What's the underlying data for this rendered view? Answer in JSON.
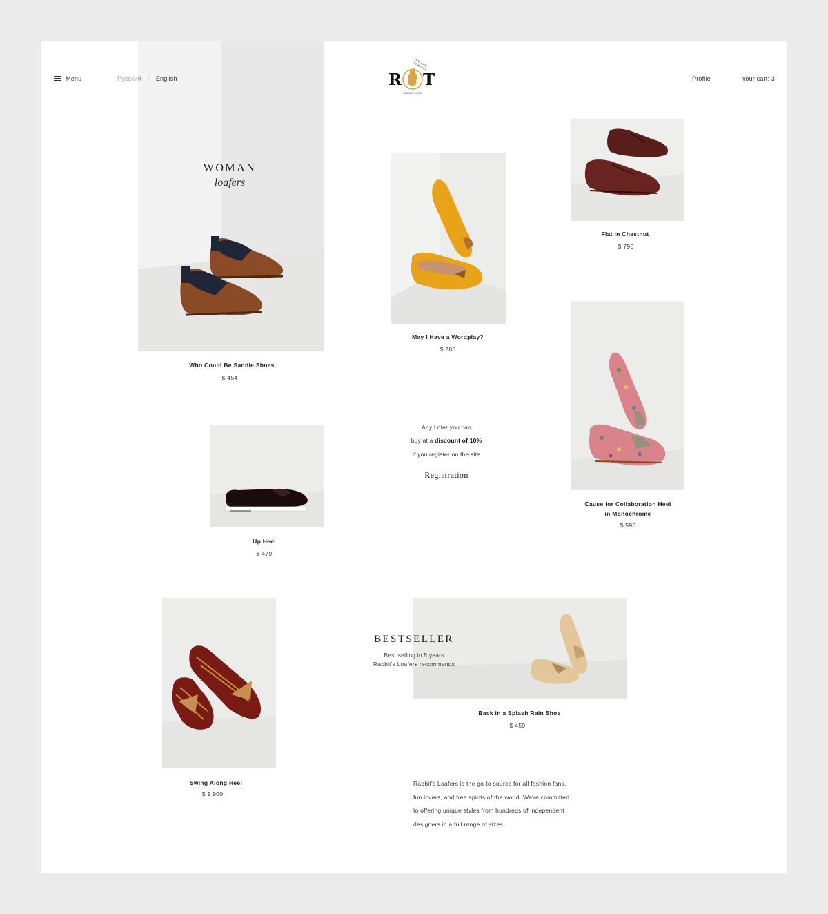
{
  "header": {
    "menu_label": "Menu",
    "languages": [
      {
        "label": "Русский",
        "active": false
      },
      {
        "label": "English",
        "active": true
      }
    ],
    "logo": {
      "letter_left": "R",
      "letter_right": "T",
      "arc_top": "WE ARE LOAFERS",
      "arc_bottom": "SINCE 2015"
    },
    "profile_label": "Profile",
    "cart_label": "Your cart: 3"
  },
  "hero": {
    "title": "WOMAN",
    "subtitle": "loafers"
  },
  "products": [
    {
      "name": "Who Could Be Saddle Shoes",
      "price": "$ 454"
    },
    {
      "name": "May I Have a Wordplay?",
      "price": "$ 280"
    },
    {
      "name": "Flat in Chestnut",
      "price": "$ 790"
    },
    {
      "name": "Up Heel",
      "price": "$ 479"
    },
    {
      "name_line1": "Cause for Collaboration Heel",
      "name_line2": "in Monochrome",
      "price": "$ 590"
    },
    {
      "name": "Swing Along Heel",
      "price": "$ 1 900"
    },
    {
      "name": "Back in a Splash Rain Shoe",
      "price": "$ 459"
    }
  ],
  "promo": {
    "line1": "Any Lofer you can",
    "line2_prefix": "buy at a ",
    "line2_bold": "discount of 10%",
    "line3": "if you register on the site",
    "cta": "Registration"
  },
  "bestseller": {
    "title": "BESTSELLER",
    "line1": "Best selling in 5 years",
    "line2": "Rabbit's Loafers recommends"
  },
  "about": {
    "lines": [
      "Rabbit's Loafers is the go-to source for all fashion fans,",
      "fun lovers, and free spirits of the world. We're committed",
      "to offering unique styles from hundreds of independent",
      "designers in a full range of sizes."
    ]
  },
  "icons": [
    "menu-icon",
    "logo-rabbit-icon"
  ],
  "colors": {
    "background": "#ebebeb",
    "page": "#ffffff",
    "logo_accent": "#d9a441"
  }
}
